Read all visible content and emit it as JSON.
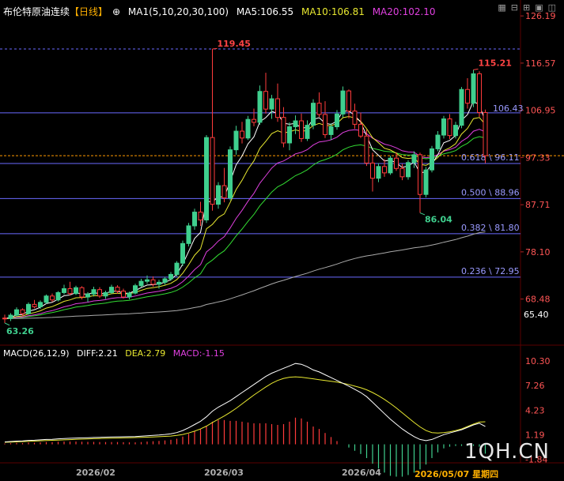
{
  "header": {
    "instrument": "布伦特原油连续",
    "period": "【日线】",
    "settings_icon": "gear-icon",
    "ma_label": "MA1(5,10,20,30,100)",
    "ma5": "MA5:106.55",
    "ma10": "MA10:106.81",
    "ma20": "MA20:102.10"
  },
  "macd_header": {
    "label": "MACD(26,12,9)",
    "diff": "DIFF:2.21",
    "dea": "DEA:2.79",
    "macd": "MACD:-1.15"
  },
  "toolbar_icons": [
    "grid-icon",
    "minus-icon",
    "plus-icon",
    "maximize-icon",
    "panel-icon"
  ],
  "watermark": "1QH.CN",
  "x_axis_labels": [
    "2026/02",
    "2026/03",
    "2026/04",
    "2026/05/07 星期四"
  ],
  "colors": {
    "up": "#3fcf8e",
    "down": "#ff3b3b",
    "ma5": "#ffffff",
    "ma10": "#e8e830",
    "ma20": "#e040e0",
    "ma30": "#33dd33",
    "ma100": "#aaaaaa",
    "fib": "#6a6aff",
    "current": "#ff9a00"
  },
  "chart_data": [
    {
      "type": "candlestick",
      "title": "布伦特原油连续【日线】",
      "ylim": [
        61.5,
        127.5
      ],
      "y_ticks": [
        "126.19",
        "116.57",
        "106.95",
        "97.33",
        "87.71",
        "78.10",
        "68.48"
      ],
      "price_labels": {
        "low_axis": "65.40",
        "high_mark": "119.45",
        "recent_high": "115.21",
        "swing_low": "86.04",
        "start_low": "63.26",
        "fib_level_top": "106.43"
      },
      "current_price": 97.7,
      "fib_levels": [
        {
          "label": "0.618 \\ 96.11",
          "value": 96.11
        },
        {
          "label": "0.500 \\ 88.96",
          "value": 88.96
        },
        {
          "label": "0.382 \\ 81.80",
          "value": 81.8
        },
        {
          "label": "0.236 \\ 72.95",
          "value": 72.95
        }
      ],
      "extra_hlines": [
        119.45,
        106.43
      ],
      "ohlc": [
        [
          64.6,
          65.3,
          63.6,
          64.5
        ],
        [
          64.5,
          65.6,
          64.0,
          65.2
        ],
        [
          65.2,
          66.8,
          64.9,
          66.3
        ],
        [
          66.3,
          66.6,
          65.0,
          65.5
        ],
        [
          65.5,
          67.8,
          65.3,
          67.4
        ],
        [
          67.4,
          68.3,
          66.6,
          66.9
        ],
        [
          66.9,
          68.2,
          66.5,
          67.8
        ],
        [
          67.8,
          69.4,
          67.5,
          69.1
        ],
        [
          69.1,
          69.6,
          67.9,
          68.3
        ],
        [
          68.3,
          70.1,
          68.0,
          69.8
        ],
        [
          69.8,
          71.4,
          69.4,
          70.6
        ],
        [
          70.6,
          72.0,
          69.2,
          69.6
        ],
        [
          69.6,
          71.2,
          69.3,
          70.8
        ],
        [
          70.8,
          71.1,
          68.4,
          68.9
        ],
        [
          68.9,
          69.9,
          67.9,
          69.5
        ],
        [
          69.5,
          71.0,
          69.0,
          70.4
        ],
        [
          70.4,
          70.9,
          68.7,
          69.1
        ],
        [
          69.1,
          70.2,
          68.5,
          69.8
        ],
        [
          69.8,
          71.4,
          69.5,
          70.9
        ],
        [
          70.9,
          71.3,
          69.6,
          70.1
        ],
        [
          70.1,
          70.6,
          68.6,
          68.9
        ],
        [
          68.9,
          70.0,
          68.4,
          69.7
        ],
        [
          69.7,
          71.6,
          69.4,
          71.2
        ],
        [
          71.2,
          72.6,
          70.9,
          72.1
        ],
        [
          72.1,
          73.3,
          71.6,
          72.4
        ],
        [
          72.4,
          73.1,
          71.0,
          71.5
        ],
        [
          71.5,
          72.4,
          70.6,
          71.9
        ],
        [
          71.9,
          73.0,
          71.4,
          72.6
        ],
        [
          72.6,
          74.0,
          72.2,
          73.5
        ],
        [
          73.5,
          76.2,
          73.1,
          75.8
        ],
        [
          75.8,
          80.4,
          75.2,
          79.8
        ],
        [
          79.8,
          84.0,
          79.2,
          83.4
        ],
        [
          83.4,
          86.9,
          82.6,
          86.2
        ],
        [
          86.2,
          88.3,
          83.4,
          84.6
        ],
        [
          84.6,
          101.9,
          84.0,
          101.4
        ],
        [
          101.4,
          119.45,
          86.5,
          87.8
        ],
        [
          87.8,
          92.3,
          86.9,
          91.6
        ],
        [
          91.6,
          95.2,
          88.2,
          89.1
        ],
        [
          89.1,
          99.6,
          88.6,
          98.9
        ],
        [
          98.9,
          103.8,
          97.9,
          102.7
        ],
        [
          102.7,
          104.6,
          100.2,
          101.3
        ],
        [
          101.3,
          105.8,
          100.9,
          105.1
        ],
        [
          105.1,
          107.3,
          103.7,
          104.5
        ],
        [
          104.5,
          112.0,
          104.0,
          110.8
        ],
        [
          110.8,
          114.6,
          106.3,
          107.2
        ],
        [
          107.2,
          110.1,
          105.2,
          109.3
        ],
        [
          109.3,
          112.4,
          104.6,
          105.5
        ],
        [
          105.5,
          107.6,
          99.4,
          100.3
        ],
        [
          100.3,
          104.5,
          98.8,
          103.6
        ],
        [
          103.6,
          105.9,
          102.1,
          104.8
        ],
        [
          104.8,
          106.3,
          100.5,
          101.2
        ],
        [
          101.2,
          104.9,
          100.7,
          103.9
        ],
        [
          103.9,
          109.2,
          103.1,
          108.4
        ],
        [
          108.4,
          110.6,
          105.6,
          106.1
        ],
        [
          106.1,
          108.8,
          101.3,
          102.0
        ],
        [
          102.0,
          104.3,
          100.9,
          103.6
        ],
        [
          103.6,
          107.0,
          103.0,
          106.2
        ],
        [
          106.2,
          111.8,
          105.5,
          110.9
        ],
        [
          110.9,
          111.2,
          105.3,
          106.8
        ],
        [
          106.8,
          108.3,
          103.2,
          104.1
        ],
        [
          104.1,
          106.5,
          101.3,
          101.7
        ],
        [
          101.7,
          103.0,
          95.6,
          96.2
        ],
        [
          96.2,
          98.3,
          90.4,
          93.1
        ],
        [
          93.1,
          96.2,
          92.3,
          95.5
        ],
        [
          95.5,
          97.0,
          93.4,
          94.2
        ],
        [
          94.2,
          97.7,
          93.8,
          97.2
        ],
        [
          97.2,
          98.4,
          94.6,
          95.1
        ],
        [
          95.1,
          96.0,
          92.7,
          93.4
        ],
        [
          93.4,
          96.8,
          92.8,
          96.3
        ],
        [
          96.3,
          98.6,
          95.2,
          97.9
        ],
        [
          97.9,
          98.3,
          86.04,
          89.8
        ],
        [
          89.8,
          95.4,
          89.2,
          94.8
        ],
        [
          94.8,
          99.7,
          94.3,
          99.1
        ],
        [
          99.1,
          102.7,
          98.6,
          101.9
        ],
        [
          101.9,
          105.8,
          101.2,
          105.2
        ],
        [
          105.2,
          106.2,
          101.1,
          101.8
        ],
        [
          101.8,
          104.6,
          101.2,
          103.9
        ],
        [
          103.9,
          111.7,
          103.3,
          111.2
        ],
        [
          111.2,
          113.5,
          107.3,
          108.4
        ],
        [
          108.4,
          115.21,
          107.6,
          114.4
        ],
        [
          114.4,
          114.9,
          105.6,
          106.5
        ],
        [
          106.5,
          107.1,
          96.2,
          97.7
        ]
      ]
    },
    {
      "type": "bar+line",
      "title": "MACD(26,12,9)",
      "ylim": [
        -1.9,
        10.8
      ],
      "y_ticks": [
        "10.30",
        "7.26",
        "4.23",
        "1.19",
        "-1.84"
      ],
      "diff_last": 2.21,
      "dea_last": 2.79,
      "macd_last": -1.15,
      "diff": [
        0.3,
        0.35,
        0.4,
        0.42,
        0.48,
        0.5,
        0.55,
        0.6,
        0.62,
        0.68,
        0.72,
        0.75,
        0.78,
        0.8,
        0.82,
        0.85,
        0.86,
        0.88,
        0.9,
        0.92,
        0.93,
        0.94,
        0.96,
        1.0,
        1.05,
        1.1,
        1.15,
        1.22,
        1.3,
        1.45,
        1.7,
        2.05,
        2.45,
        2.85,
        3.4,
        4.1,
        4.6,
        5.0,
        5.4,
        5.9,
        6.4,
        6.9,
        7.4,
        7.9,
        8.4,
        8.8,
        9.1,
        9.4,
        9.7,
        10.0,
        9.9,
        9.6,
        9.2,
        8.95,
        8.6,
        8.25,
        7.9,
        7.55,
        7.2,
        6.8,
        6.4,
        5.9,
        5.2,
        4.5,
        3.8,
        3.1,
        2.5,
        1.9,
        1.4,
        0.95,
        0.6,
        0.45,
        0.6,
        0.9,
        1.2,
        1.4,
        1.6,
        1.8,
        2.1,
        2.4,
        2.6,
        2.21
      ],
      "dea": [
        0.25,
        0.28,
        0.31,
        0.34,
        0.37,
        0.4,
        0.43,
        0.46,
        0.49,
        0.52,
        0.55,
        0.58,
        0.61,
        0.64,
        0.67,
        0.7,
        0.72,
        0.74,
        0.76,
        0.78,
        0.8,
        0.82,
        0.84,
        0.86,
        0.88,
        0.91,
        0.94,
        0.98,
        1.02,
        1.1,
        1.22,
        1.4,
        1.63,
        1.9,
        2.25,
        2.7,
        3.1,
        3.5,
        3.95,
        4.45,
        5.0,
        5.55,
        6.1,
        6.6,
        7.1,
        7.55,
        7.9,
        8.15,
        8.3,
        8.35,
        8.3,
        8.2,
        8.1,
        8.0,
        7.9,
        7.8,
        7.7,
        7.55,
        7.4,
        7.2,
        7.0,
        6.75,
        6.4,
        6.0,
        5.55,
        5.05,
        4.5,
        3.9,
        3.3,
        2.7,
        2.15,
        1.7,
        1.45,
        1.4,
        1.45,
        1.55,
        1.7,
        1.9,
        2.2,
        2.5,
        2.75,
        2.79
      ]
    }
  ]
}
